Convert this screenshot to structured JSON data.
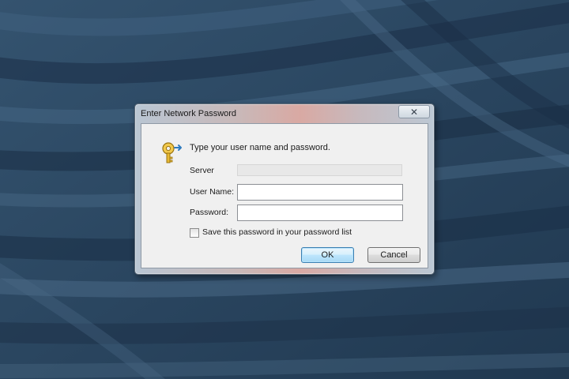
{
  "dialog": {
    "title": "Enter Network Password",
    "prompt": "Type your user name and password.",
    "server": {
      "label": "Server",
      "value": ""
    },
    "username": {
      "label": "User Name:",
      "value": ""
    },
    "password": {
      "label": "Password:",
      "value": ""
    },
    "save_password": {
      "label": "Save this password in your password list",
      "checked": false
    },
    "ok_label": "OK",
    "cancel_label": "Cancel",
    "close_glyph": "✕",
    "icon": "key-icon"
  },
  "colors": {
    "desktop_background": "#2a4560",
    "ok_button_border": "#3c7fb1",
    "client_background": "#f0f0f0"
  }
}
